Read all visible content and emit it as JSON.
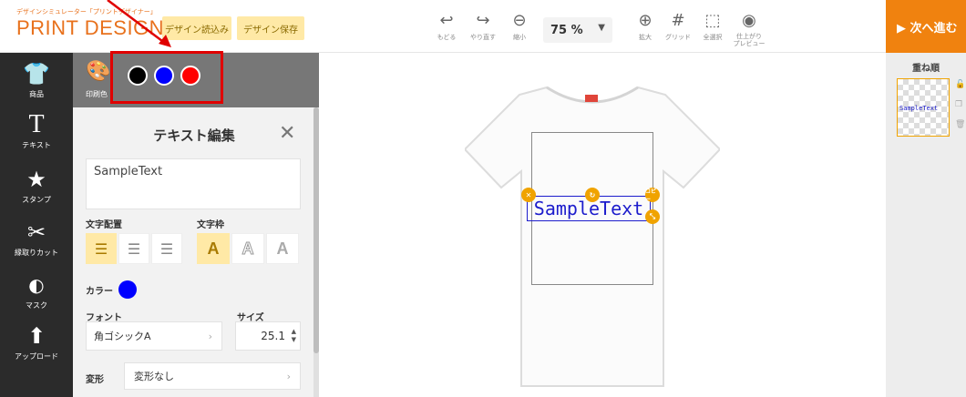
{
  "header": {
    "logo_sub": "デザインシミュレーター「プリントデザイナー」",
    "logo_main": "PRINT DESIGNER",
    "load_label": "デザイン読込み",
    "save_label": "デザイン保存",
    "tools": {
      "undo": "もどる",
      "redo": "やり直す",
      "zoom_out": "縮小",
      "zoom_in": "拡大",
      "grid": "グリッド",
      "select_all": "全選択",
      "preview": "仕上がり\nプレビュー"
    },
    "zoom_value": "75 %",
    "next_label": "▶ 次へ進む"
  },
  "sidebar": {
    "items": [
      {
        "label": "商品",
        "icon": "tshirt-icon"
      },
      {
        "label": "テキスト",
        "icon": "text-icon"
      },
      {
        "label": "スタンプ",
        "icon": "stamp-icon"
      },
      {
        "label": "縁取りカット",
        "icon": "cut-icon"
      },
      {
        "label": "マスク",
        "icon": "mask-icon"
      },
      {
        "label": "アップロード",
        "icon": "upload-icon"
      }
    ]
  },
  "panel": {
    "print_label": "印刷色",
    "colors": [
      "#000000",
      "#0000ff",
      "#ff0000"
    ]
  },
  "editor": {
    "title": "テキスト編集",
    "text_value": "SampleText",
    "align_label": "文字配置",
    "frame_label": "文字枠",
    "frame_glyph": "A",
    "color_label": "カラー",
    "selected_color": "#0000ff",
    "font_label": "フォント",
    "font_value": "角ゴシックA",
    "size_label": "サイズ",
    "size_value": "25.1",
    "transform_label": "変形",
    "transform_value": "変形なし"
  },
  "canvas": {
    "sample_text": "SampleText",
    "copy_label": "コピー"
  },
  "layers": {
    "title": "重ね順",
    "item_text": "SampleText"
  }
}
